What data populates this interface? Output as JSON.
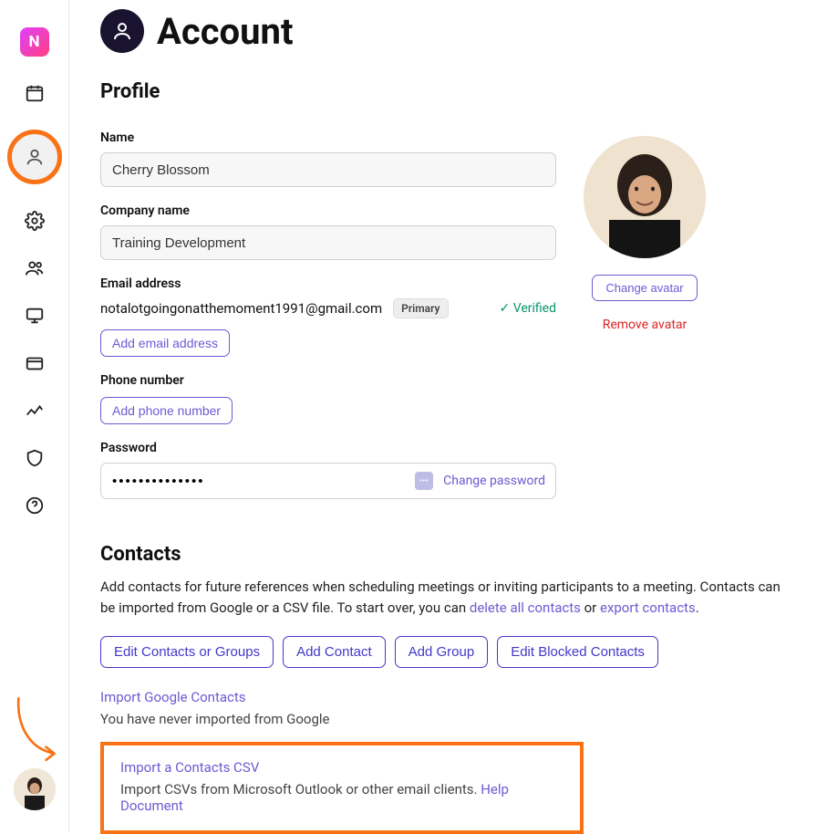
{
  "header": {
    "logo_letter": "N",
    "title": "Account"
  },
  "profile": {
    "section_title": "Profile",
    "name_label": "Name",
    "name_value": "Cherry Blossom",
    "company_label": "Company name",
    "company_value": "Training Development",
    "email_label": "Email address",
    "email_value": "notalotgoingonatthemoment1991@gmail.com",
    "email_badge": "Primary",
    "email_verified": "✓ Verified",
    "add_email_btn": "Add email address",
    "phone_label": "Phone number",
    "add_phone_btn": "Add phone number",
    "password_label": "Password",
    "password_value": "••••••••••••••",
    "change_password": "Change password",
    "change_avatar": "Change avatar",
    "remove_avatar": "Remove avatar"
  },
  "contacts": {
    "section_title": "Contacts",
    "desc_1": "Add contacts for future references when scheduling meetings or inviting participants to a meeting. Contacts can be imported from Google or a CSV file. To start over, you can ",
    "delete_link": "delete all contacts",
    "desc_or": " or ",
    "export_link": "export contacts",
    "desc_end": ".",
    "btn_edit_contacts": "Edit Contacts or Groups",
    "btn_add_contact": "Add Contact",
    "btn_add_group": "Add Group",
    "btn_edit_blocked": "Edit Blocked Contacts",
    "import_google_link": "Import Google Contacts",
    "import_google_note": "You have never imported from Google",
    "import_csv_link": "Import a Contacts CSV",
    "import_csv_note_1": "Import CSVs from Microsoft Outlook or other email clients. ",
    "import_csv_help": "Help Document"
  }
}
